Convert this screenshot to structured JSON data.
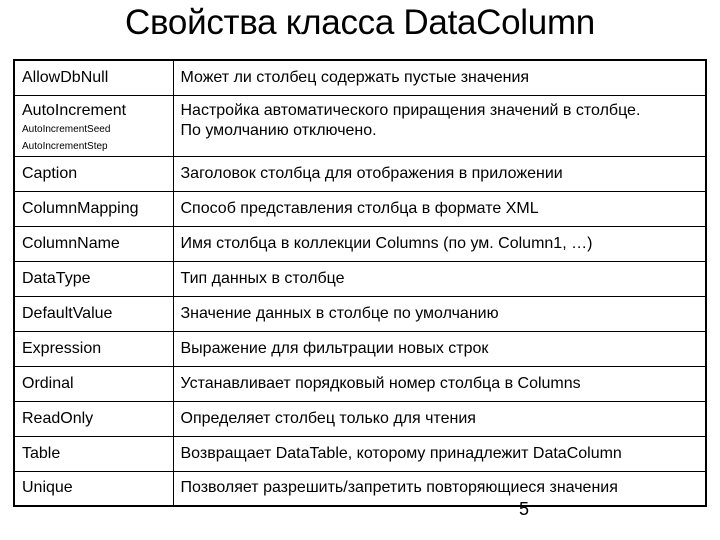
{
  "title": "Свойства класса DataColumn",
  "page_number": "5",
  "properties": [
    {
      "name": "AllowDbNull",
      "description": "Может ли столбец содержать пустые значения"
    },
    {
      "name": "AutoIncrement",
      "sub": [
        "AutoIncrementSeed",
        "AutoIncrementStep"
      ],
      "description_lines": [
        "Настройка автоматического приращения значений в столбце.",
        "По умолчанию отключено."
      ]
    },
    {
      "name": "Caption",
      "description": "Заголовок столбца для отображения в приложении"
    },
    {
      "name": "ColumnMapping",
      "description": "Способ представления столбца в формате XML"
    },
    {
      "name": "ColumnName",
      "description": "Имя столбца в коллекции Columns (по ум. Column1, …)"
    },
    {
      "name": "DataType",
      "description": "Тип данных в столбце"
    },
    {
      "name": "DefaultValue",
      "description": "Значение данных в столбце по умолчанию"
    },
    {
      "name": "Expression",
      "description": "Выражение для фильтрации новых строк"
    },
    {
      "name": "Ordinal",
      "description": "Устанавливает порядковый номер столбца в Columns"
    },
    {
      "name": "ReadOnly",
      "description": "Определяет столбец только для чтения"
    },
    {
      "name": "Table",
      "description": "Возвращает DataTable, которому принадлежит DataColumn"
    },
    {
      "name": "Unique",
      "description": "Позволяет разрешить/запретить повторяющиеся значения"
    }
  ]
}
